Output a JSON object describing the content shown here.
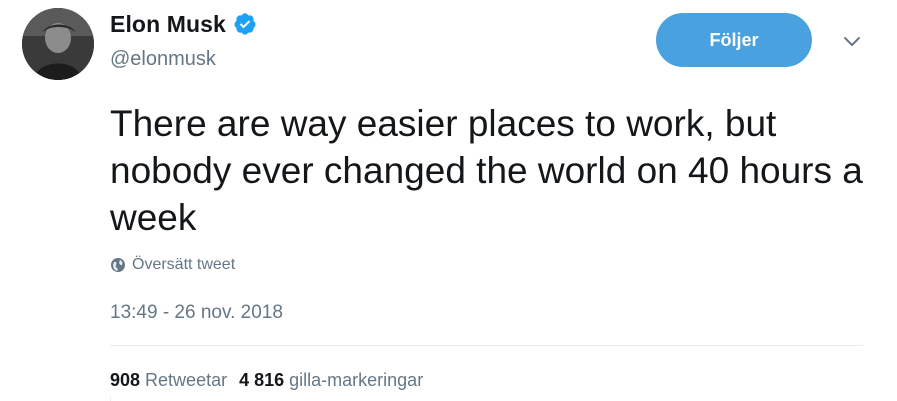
{
  "profile": {
    "display_name": "Elon Musk",
    "handle": "@elonmusk",
    "verified": true,
    "avatar_icon": "user-avatar-photo"
  },
  "follow_button": {
    "label": "Följer"
  },
  "menu_icon": "chevron-down-icon",
  "tweet": {
    "text": "There are way easier places to work, but nobody ever changed the world on 40 hours a week",
    "translated_label": "Översätt tweet",
    "timestamp": "13:49 - 26 nov. 2018"
  },
  "stats": {
    "retweets_count": "908",
    "retweets_label": "Retweetar",
    "likes_count": "4 816",
    "likes_label": "gilla-markeringar"
  },
  "colors": {
    "accent": "#4aa1e0",
    "verified": "#1da1f2",
    "text": "#14171a",
    "secondary": "#657786",
    "divider": "#e6ecf0"
  }
}
